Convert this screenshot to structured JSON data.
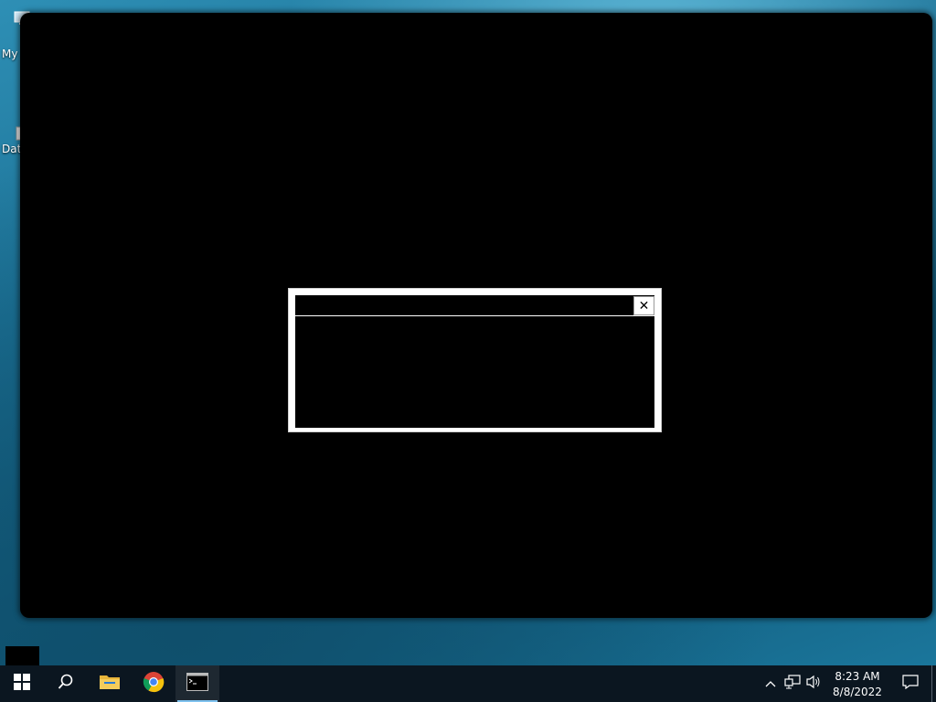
{
  "desktop": {
    "icons": [
      {
        "label": "My",
        "icon": "computer-icon"
      },
      {
        "label": "Dat",
        "icon": "database-icon"
      }
    ]
  },
  "dialog": {
    "title": "",
    "body": "",
    "close_symbol": "✕"
  },
  "taskbar": {
    "items": [
      {
        "name": "start-button",
        "icon": "windows-logo-icon"
      },
      {
        "name": "search-button",
        "icon": "search-icon"
      },
      {
        "name": "file-explorer-button",
        "icon": "folder-icon"
      },
      {
        "name": "chrome-button",
        "icon": "chrome-icon"
      },
      {
        "name": "cmd-button",
        "icon": "command-prompt-icon",
        "active": true
      }
    ],
    "tray": {
      "chevron": "^",
      "time": "8:23 AM",
      "date": "8/8/2022"
    }
  },
  "colors": {
    "taskbar_bg": "#0b1620",
    "accent": "#7fc2ef",
    "window_bg": "#000000"
  }
}
